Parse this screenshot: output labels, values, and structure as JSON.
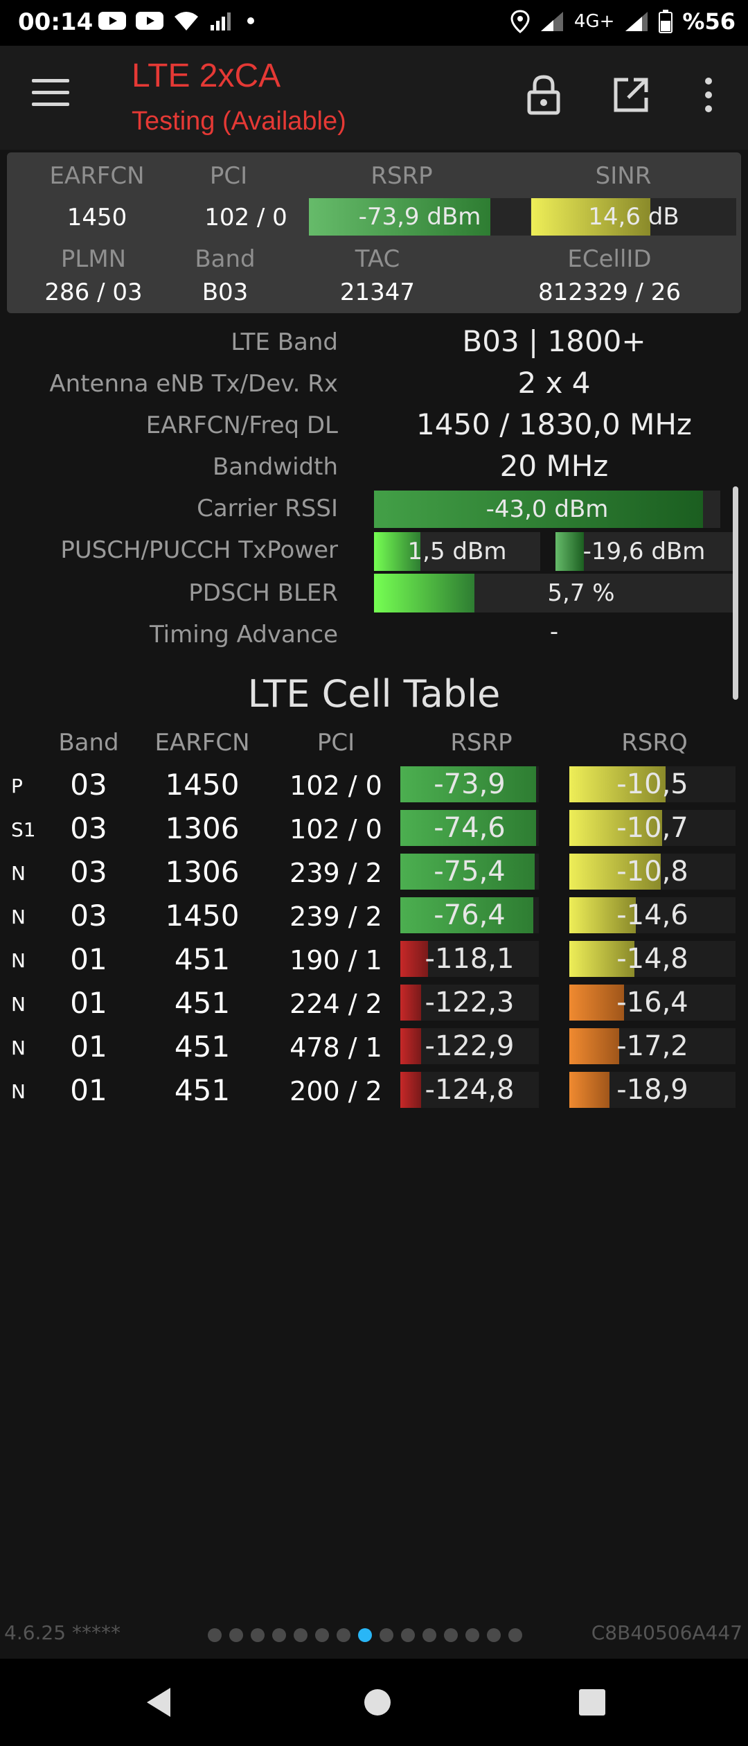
{
  "status_bar": {
    "time": "00:14",
    "network": "4G+",
    "battery": "%56",
    "icons": [
      "youtube-icon",
      "youtube-icon",
      "wifi-icon",
      "signal-icon",
      "dot-icon",
      "location-icon",
      "signal-icon",
      "signal-icon",
      "battery-icon"
    ]
  },
  "app_bar": {
    "title": "LTE 2xCA",
    "subtitle": "Testing (Available)",
    "accent_color": "#e53935",
    "icons": [
      "menu-icon",
      "lock-icon",
      "open-external-icon",
      "more-vert-icon"
    ]
  },
  "summary": {
    "labels": {
      "earfcn": "EARFCN",
      "pci": "PCI",
      "rsrp": "RSRP",
      "sinr": "SINR",
      "plmn": "PLMN",
      "band": "Band",
      "tac": "TAC",
      "ecellid": "ECellID"
    },
    "earfcn": "1450",
    "pci": "102 / 0",
    "rsrp": "-73,9 dBm",
    "rsrp_level": 0.82,
    "sinr": "14,6 dB",
    "sinr_level": 0.58,
    "plmn": "286 / 03",
    "band": "B03",
    "tac": "21347",
    "ecellid": "812329 / 26"
  },
  "details": {
    "lte_band_label": "LTE Band",
    "lte_band": "B03 | 1800+",
    "antenna_label": "Antenna eNB Tx/Dev. Rx",
    "antenna": "2 x 4",
    "earfcn_freq_label": "EARFCN/Freq DL",
    "earfcn_freq": "1450 / 1830,0 MHz",
    "bandwidth_label": "Bandwidth",
    "bandwidth": "20 MHz",
    "carrier_rssi_label": "Carrier RSSI",
    "carrier_rssi": "-43,0 dBm",
    "carrier_rssi_level": 0.95,
    "txpower_label": "PUSCH/PUCCH TxPower",
    "pusch_txpower": "1,5 dBm",
    "pusch_level": 0.28,
    "pucch_txpower": "-19,6 dBm",
    "pucch_level": 0.16,
    "bler_label": "PDSCH BLER",
    "bler": "5,7 %",
    "bler_level": 0.28,
    "timing_advance_label": "Timing Advance",
    "timing_advance": "-"
  },
  "cell_table": {
    "title": "LTE Cell Table",
    "headers": {
      "band": "Band",
      "earfcn": "EARFCN",
      "pci": "PCI",
      "rsrp": "RSRP",
      "rsrq": "RSRQ"
    },
    "rows": [
      {
        "type": "P",
        "band": "03",
        "earfcn": "1450",
        "pci": "102 / 0",
        "rsrp": "-73,9",
        "rsrp_level": 0.98,
        "rsrq": "-10,5",
        "rsrq_level": 0.58
      },
      {
        "type": "S1",
        "band": "03",
        "earfcn": "1306",
        "pci": "102 / 0",
        "rsrp": "-74,6",
        "rsrp_level": 0.98,
        "rsrq": "-10,7",
        "rsrq_level": 0.56
      },
      {
        "type": "N",
        "band": "03",
        "earfcn": "1306",
        "pci": "239 / 2",
        "rsrp": "-75,4",
        "rsrp_level": 0.97,
        "rsrq": "-10,8",
        "rsrq_level": 0.55
      },
      {
        "type": "N",
        "band": "03",
        "earfcn": "1450",
        "pci": "239 / 2",
        "rsrp": "-76,4",
        "rsrp_level": 0.96,
        "rsrq": "-14,6",
        "rsrq_level": 0.4
      },
      {
        "type": "N",
        "band": "01",
        "earfcn": "451",
        "pci": "190 / 1",
        "rsrp": "-118,1",
        "rsrp_level": 0.2,
        "rsrq": "-14,8",
        "rsrq_level": 0.39
      },
      {
        "type": "N",
        "band": "01",
        "earfcn": "451",
        "pci": "224 / 2",
        "rsrp": "-122,3",
        "rsrp_level": 0.15,
        "rsrq": "-16,4",
        "rsrq_level": 0.33
      },
      {
        "type": "N",
        "band": "01",
        "earfcn": "451",
        "pci": "478 / 1",
        "rsrp": "-122,9",
        "rsrp_level": 0.15,
        "rsrq": "-17,2",
        "rsrq_level": 0.3
      },
      {
        "type": "N",
        "band": "01",
        "earfcn": "451",
        "pci": "200 / 2",
        "rsrp": "-124,8",
        "rsrp_level": 0.15,
        "rsrq": "-18,9",
        "rsrq_level": 0.24
      }
    ]
  },
  "footer": {
    "version": "4.6.25 *****",
    "cell_id": "C8B40506A447",
    "page_count": 15,
    "active_page": 8
  },
  "nav_bar": {
    "icons": [
      "back-icon",
      "home-icon",
      "recents-icon"
    ]
  }
}
